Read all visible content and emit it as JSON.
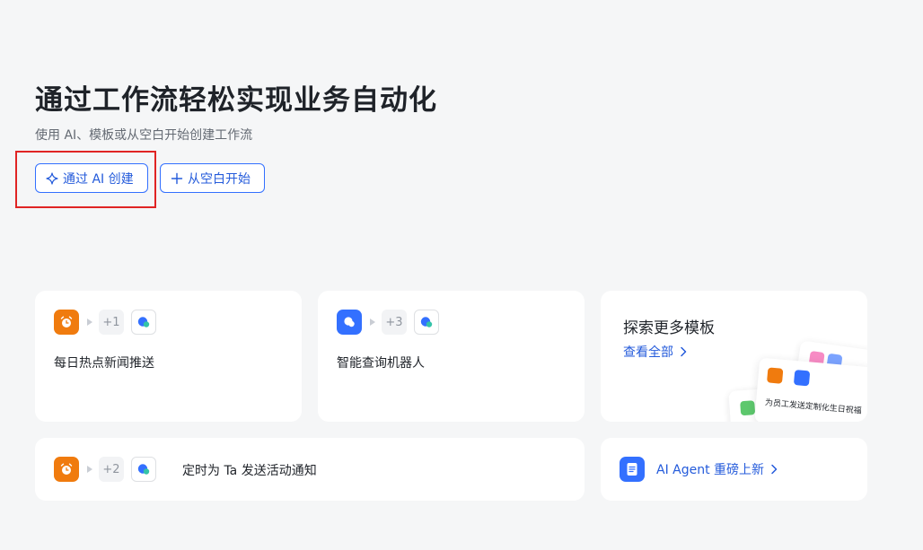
{
  "header": {
    "title": "通过工作流轻松实现业务自动化",
    "subtitle": "使用 AI、模板或从空白开始创建工作流"
  },
  "actions": {
    "ai_create_label": "通过 AI 创建",
    "blank_start_label": "从空白开始"
  },
  "templates": [
    {
      "label": "每日热点新闻推送",
      "extra_steps": "+1",
      "trigger_icon": "alarm-clock-icon"
    },
    {
      "label": "智能查询机器人",
      "extra_steps": "+3",
      "trigger_icon": "chat-bubble-icon"
    },
    {
      "label": "定时为 Ta 发送活动通知",
      "extra_steps": "+2",
      "trigger_icon": "alarm-clock-icon"
    }
  ],
  "explore": {
    "title": "探索更多模板",
    "link_label": "查看全部",
    "preview_text": "为员工发送定制化生日祝福"
  },
  "agent_banner": {
    "label": "AI Agent 重磅上新"
  },
  "colors": {
    "accent": "#3370ff",
    "orange": "#f07b0e",
    "highlight": "#e02424"
  }
}
